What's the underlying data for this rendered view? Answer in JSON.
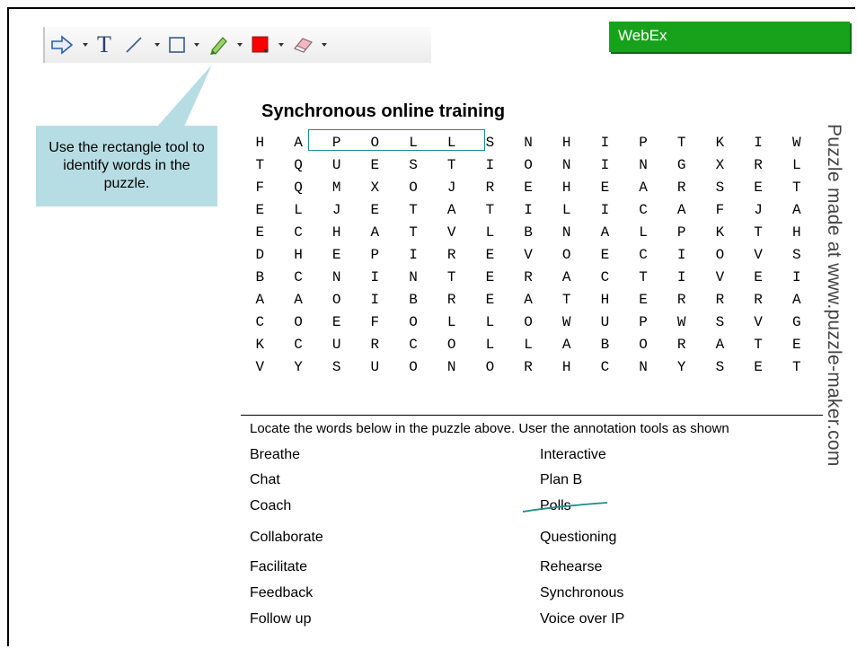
{
  "webex_label": "WebEx",
  "toolbar": {
    "tools": [
      "arrow-pointer-icon",
      "text-icon",
      "line-icon",
      "rectangle-icon",
      "highlighter-icon",
      "color-icon",
      "eraser-icon"
    ],
    "text_tool_glyph": "T",
    "color_swatch": "#ff0000"
  },
  "callout_text": "Use the rectangle tool to identify words in the puzzle.",
  "puzzle": {
    "title": "Synchronous online training",
    "grid": [
      [
        "H",
        "A",
        "P",
        "O",
        "L",
        "L",
        "S",
        "N",
        "H",
        "I",
        "P",
        "T",
        "K",
        "I",
        "W"
      ],
      [
        "T",
        "Q",
        "U",
        "E",
        "S",
        "T",
        "I",
        "O",
        "N",
        "I",
        "N",
        "G",
        "X",
        "R",
        "L"
      ],
      [
        "F",
        "Q",
        "M",
        "X",
        "O",
        "J",
        "R",
        "E",
        "H",
        "E",
        "A",
        "R",
        "S",
        "E",
        "T"
      ],
      [
        "E",
        "L",
        "J",
        "E",
        "T",
        "A",
        "T",
        "I",
        "L",
        "I",
        "C",
        "A",
        "F",
        "J",
        "A"
      ],
      [
        "E",
        "C",
        "H",
        "A",
        "T",
        "V",
        "L",
        "B",
        "N",
        "A",
        "L",
        "P",
        "K",
        "T",
        "H"
      ],
      [
        "D",
        "H",
        "E",
        "P",
        "I",
        "R",
        "E",
        "V",
        "O",
        "E",
        "C",
        "I",
        "O",
        "V",
        "S"
      ],
      [
        "B",
        "C",
        "N",
        "I",
        "N",
        "T",
        "E",
        "R",
        "A",
        "C",
        "T",
        "I",
        "V",
        "E",
        "I"
      ],
      [
        "A",
        "A",
        "O",
        "I",
        "B",
        "R",
        "E",
        "A",
        "T",
        "H",
        "E",
        "R",
        "R",
        "R",
        "A"
      ],
      [
        "C",
        "O",
        "E",
        "F",
        "O",
        "L",
        "L",
        "O",
        "W",
        "U",
        "P",
        "W",
        "S",
        "V",
        "G"
      ],
      [
        "K",
        "C",
        "U",
        "R",
        "C",
        "O",
        "L",
        "L",
        "A",
        "B",
        "O",
        "R",
        "A",
        "T",
        "E"
      ],
      [
        "V",
        "Y",
        "S",
        "U",
        "O",
        "N",
        "O",
        "R",
        "H",
        "C",
        "N",
        "Y",
        "S",
        "E",
        "T"
      ]
    ],
    "highlight_color": "#1f8a8a"
  },
  "instructions": "Locate the words below in the puzzle above. User the annotation tools as shown",
  "words_left": [
    "Breathe",
    "Chat",
    "Coach",
    "Collaborate",
    "Facilitate",
    "Feedback",
    "Follow up"
  ],
  "words_right": [
    "Interactive",
    "Plan B",
    "Polls",
    "Questioning",
    "Rehearse",
    "Synchronous",
    "Voice over IP"
  ],
  "side_credit": "Puzzle made at www.puzzle-maker.com"
}
